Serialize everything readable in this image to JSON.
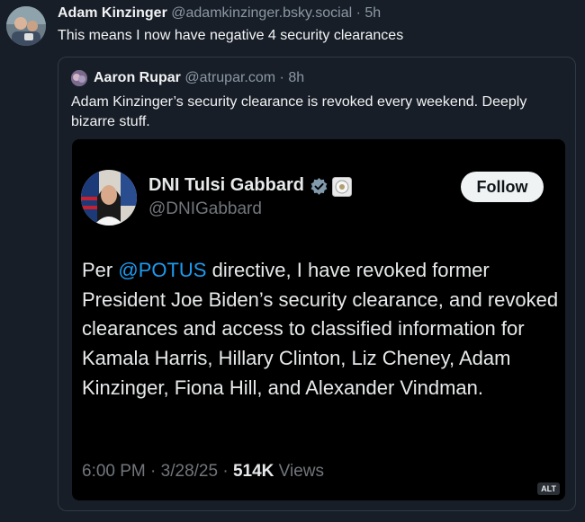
{
  "post": {
    "author_name": "Adam Kinzinger",
    "author_handle": "@adamkinzinger.bsky.social",
    "time": "5h",
    "text": "This means I now have negative 4 security clearances"
  },
  "quote": {
    "author_name": "Aaron Rupar",
    "author_handle": "@atrupar.com",
    "time": "8h",
    "text": "Adam Kinzinger’s security clearance is revoked every weekend. Deeply bizarre stuff."
  },
  "embed": {
    "name": "DNI Tulsi Gabbard",
    "handle": "@DNIGabbard",
    "follow_label": "Follow",
    "body_prefix": "Per ",
    "mention": "@POTUS",
    "body_rest": " directive, I have revoked former President Joe Biden’s security clearance, and revoked clearances and access to classified information for Kamala Harris, Hillary Clinton, Liz Cheney, Adam Kinzinger, Fiona Hill, and Alexander Vindman.",
    "time": "6:00 PM",
    "date": "3/28/25",
    "views_count": "514K",
    "views_label": "Views",
    "alt_label": "ALT"
  },
  "icons": {
    "verified": "verified-badge-icon",
    "seal": "government-seal-icon"
  },
  "colors": {
    "background": "#181e27",
    "mention": "#1d9bf0",
    "muted": "#8b98a5"
  }
}
